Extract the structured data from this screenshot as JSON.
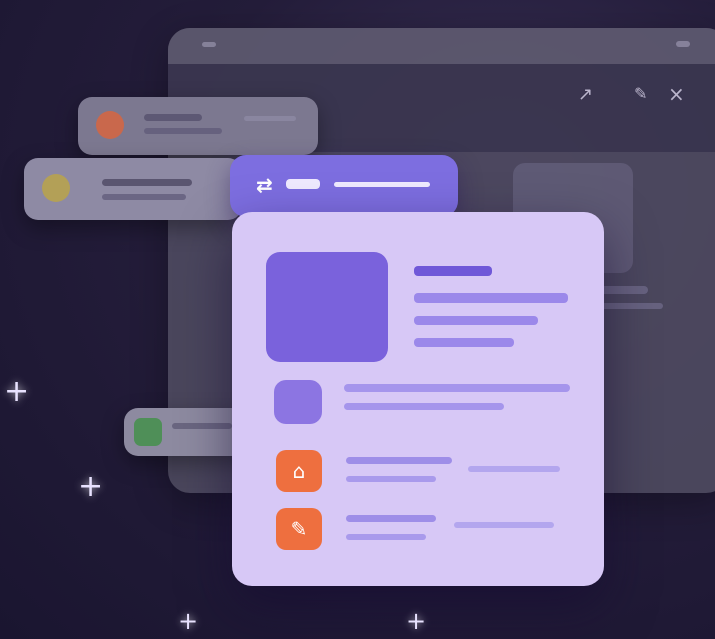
{
  "icons": {
    "header_left": "link-icon",
    "toolbar": [
      "share-icon",
      "edit-icon",
      "close-icon"
    ],
    "notification_1": "tool-icon",
    "notification_2": "emoji-icon",
    "notification_3": "image-icon",
    "app_1": "home-icon",
    "app_2": "pen-icon"
  },
  "glyphs": {
    "share": "↗",
    "edit": "✎",
    "close": "×",
    "app_1": "⌂",
    "app_2": "✎",
    "link": "⇄",
    "sparkle": "+"
  },
  "colors": {
    "accent": "#7d6ee0",
    "panel": "#d7c8f6",
    "skeleton": "#8f79e6",
    "app_icon": "#ee6f3f"
  }
}
